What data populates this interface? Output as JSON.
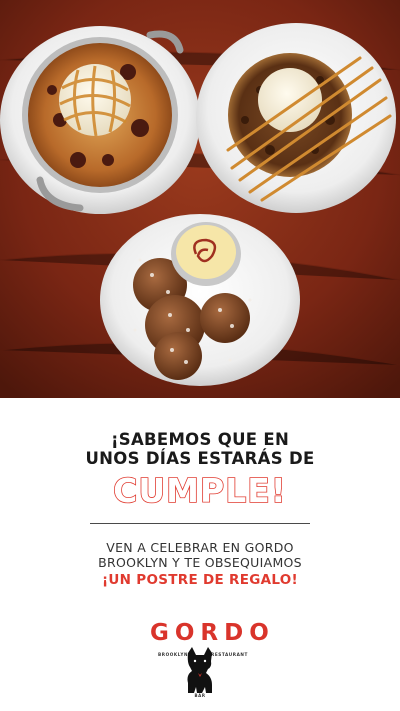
{
  "headline": {
    "line1": "¡SABEMOS QUE EN",
    "line2": "UNOS DÍAS ESTARÁS DE",
    "highlight": "CUMPLE!"
  },
  "body": {
    "line1": "VEN A CELEBRAR EN GORDO",
    "line2": "BROOKLYN Y TE OBSEQUIAMOS",
    "gift": "¡UN POSTRE DE REGALO!"
  },
  "logo": {
    "word": "GORDO",
    "left_tag": "BROOKLYN",
    "right_tag": "RESTAURANT",
    "bottom_tag": "BAR"
  },
  "colors": {
    "accent": "#e03a2f",
    "text": "#1a1a1a",
    "table": "#7a2614"
  },
  "photo_subject": "three-desserts-on-plates-icon"
}
